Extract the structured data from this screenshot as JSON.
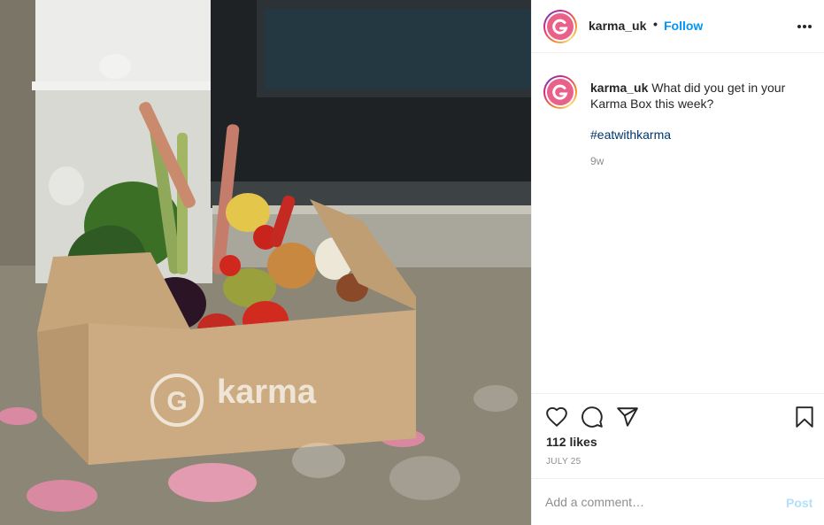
{
  "photo": {
    "box_brand_text": "karma",
    "alt_subject": "Cardboard Karma box filled with vegetables on a doorstep"
  },
  "header": {
    "username": "karma_uk",
    "separator": "•",
    "follow_label": "Follow",
    "more_icon": "more-horizontal-icon"
  },
  "caption": {
    "username": "karma_uk",
    "text": " What did you get in your Karma Box this week?",
    "hashtag": "#eatwithkarma",
    "time_ago": "9w"
  },
  "actions": {
    "icons": [
      "heart-icon",
      "comment-icon",
      "share-icon",
      "bookmark-icon"
    ],
    "likes": "112 likes",
    "date": "JULY 25"
  },
  "comment": {
    "placeholder": "Add a comment…",
    "post_label": "Post"
  },
  "colors": {
    "accent_blue": "#0095f6",
    "post_disabled": "#b2dffc",
    "hashtag": "#00376b",
    "brand_pink": "#e9618a"
  }
}
